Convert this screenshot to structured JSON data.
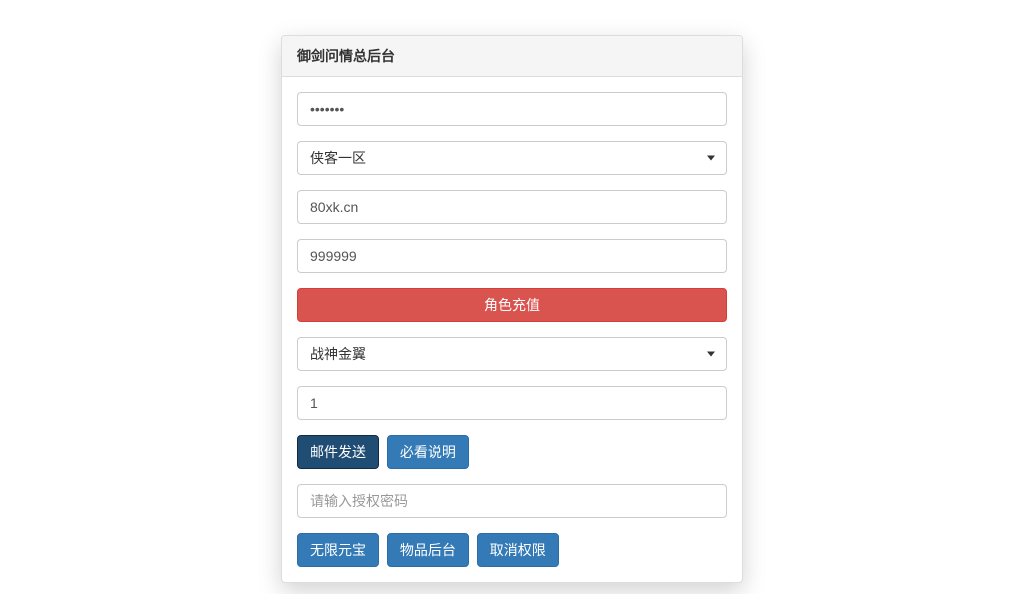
{
  "panel": {
    "title": "御剑问情总后台"
  },
  "fields": {
    "password_value": "•••••••",
    "server_select": "侠客一区",
    "domain_value": "80xk.cn",
    "amount_value": "999999",
    "recharge_button": "角色充值",
    "item_select": "战神金翼",
    "quantity_value": "1",
    "mail_send_button": "邮件发送",
    "must_read_button": "必看说明",
    "auth_placeholder": "请输入授权密码",
    "unlimited_gold_button": "无限元宝",
    "item_backend_button": "物品后台",
    "revoke_button": "取消权限"
  }
}
